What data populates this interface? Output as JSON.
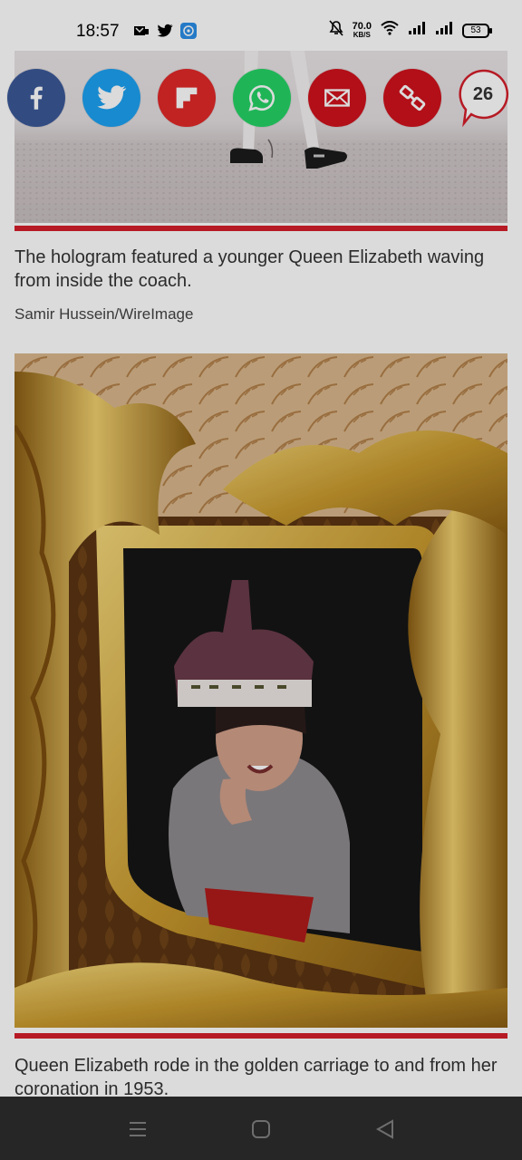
{
  "status_bar": {
    "time": "18:57",
    "net_speed_value": "70.0",
    "net_speed_unit": "KB/S",
    "battery": "53",
    "left_icons": [
      "messaging-icon",
      "twitter-icon",
      "app-icon"
    ],
    "right_icons": [
      "mute-icon",
      "wifi-icon",
      "signal-icon",
      "signal-icon",
      "battery-icon"
    ]
  },
  "share_bar": {
    "buttons": [
      {
        "name": "facebook",
        "icon": "facebook-icon",
        "color": "#3b5998"
      },
      {
        "name": "twitter",
        "icon": "twitter-icon",
        "color": "#1da1f2"
      },
      {
        "name": "flipboard",
        "icon": "flipboard-icon",
        "color": "#e12828"
      },
      {
        "name": "whatsapp",
        "icon": "whatsapp-icon",
        "color": "#25d366"
      },
      {
        "name": "email",
        "icon": "email-icon",
        "color": "#d0121c"
      },
      {
        "name": "copy-link",
        "icon": "link-icon",
        "color": "#d0121c"
      }
    ],
    "comment_count": "26"
  },
  "article": {
    "figure1": {
      "caption": "The hologram featured a younger Queen Elizabeth waving from inside the coach.",
      "credit": "Samir Hussein/WireImage"
    },
    "figure2": {
      "caption": "Queen Elizabeth rode in the golden carriage to and from her coronation in 1953."
    },
    "accent_color": "#d41f2b"
  },
  "nav_bar": {
    "buttons": [
      "menu-icon",
      "home-icon",
      "back-icon"
    ]
  }
}
